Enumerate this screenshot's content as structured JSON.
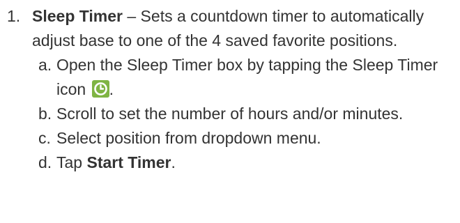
{
  "instruction": {
    "number": "1.",
    "title": "Sleep Timer",
    "description": " – Sets a countdown timer to automatically adjust base to one of the 4 saved favorite positions.",
    "steps": [
      {
        "letter": "a.",
        "text": "Open the Sleep Timer box by tapping the Sleep Timer icon",
        "suffix": "."
      },
      {
        "letter": "b.",
        "text": "Scroll to set the number of hours and/or minutes."
      },
      {
        "letter": "c.",
        "text": "Select position from dropdown menu."
      },
      {
        "letter": "d.",
        "text": "Tap ",
        "bold": "Start Timer",
        "suffix": "."
      }
    ],
    "icon": "clock-icon",
    "icon_color": "#7fb443"
  }
}
